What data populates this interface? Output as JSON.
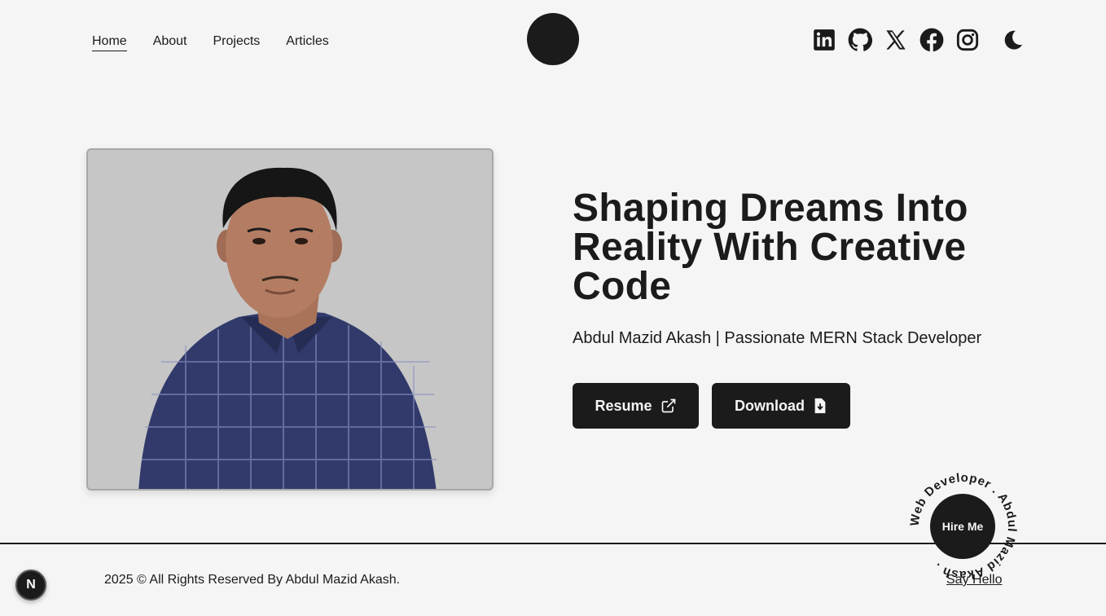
{
  "nav": {
    "items": [
      {
        "label": "Home",
        "active": true
      },
      {
        "label": "About",
        "active": false
      },
      {
        "label": "Projects",
        "active": false
      },
      {
        "label": "Articles",
        "active": false
      }
    ]
  },
  "social": [
    "linkedin-icon",
    "github-icon",
    "x-icon",
    "facebook-icon",
    "instagram-icon",
    "moon-icon"
  ],
  "hero": {
    "title": "Shaping Dreams Into Reality With Creative Code",
    "subtitle": "Abdul Mazid Akash | Passionate MERN Stack Developer",
    "resume_label": "Resume",
    "download_label": "Download"
  },
  "hire": {
    "button_label": "Hire Me",
    "ring_text": "Web Developer . Abdul Mazid Akash . "
  },
  "footer": {
    "copyright": "2025 © All Rights Reserved By Abdul Mazid Akash.",
    "say_hello": "Say Hello"
  },
  "next_badge": "N",
  "colors": {
    "background": "#f5f5f5",
    "dark": "#1b1b1b"
  }
}
